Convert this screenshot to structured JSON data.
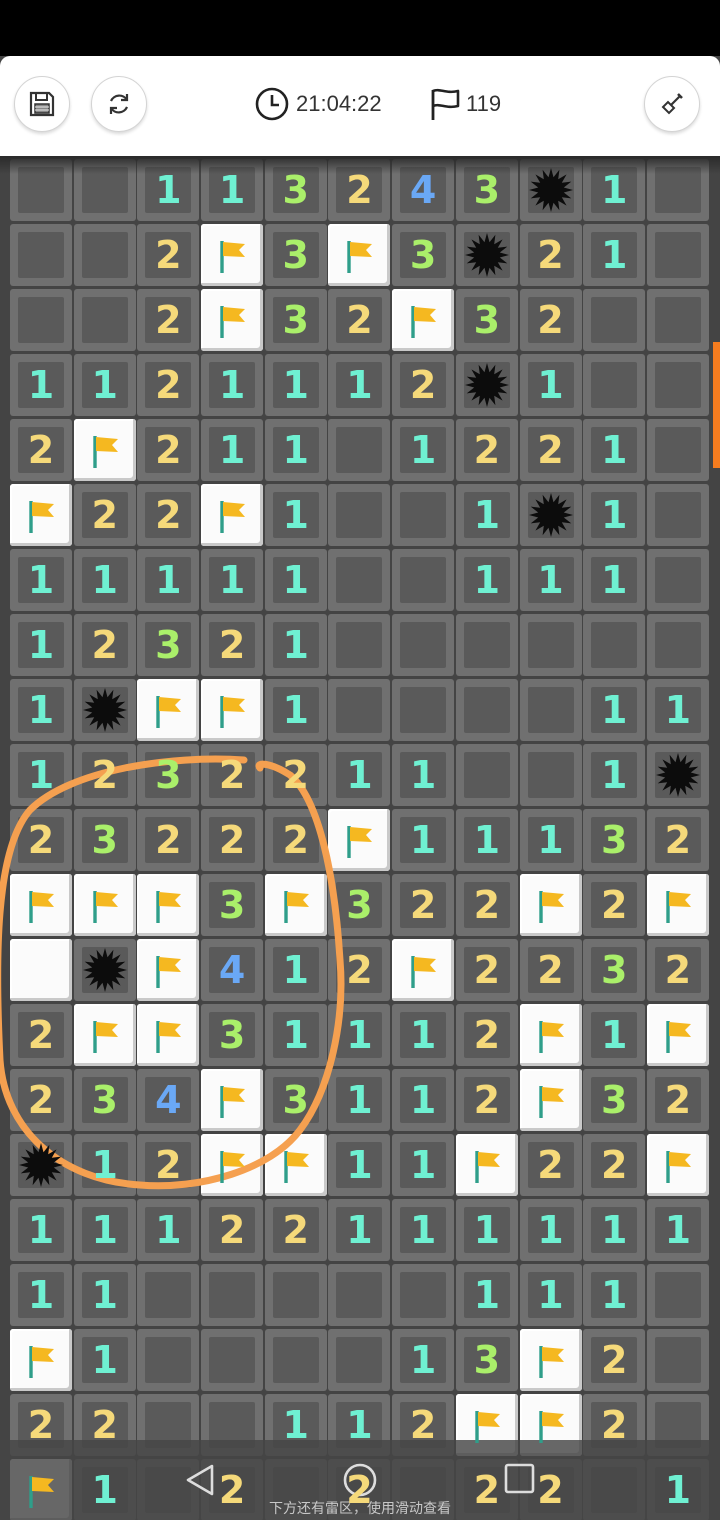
{
  "toolbar": {
    "timer": "21:04:22",
    "flag_count": "119",
    "save_icon": "floppy-disk-icon",
    "restart_icon": "refresh-icon",
    "clock_icon": "clock-icon",
    "flag_icon": "flag-outline-icon",
    "shovel_icon": "shovel-icon"
  },
  "board": {
    "columns": 11,
    "legend": "N = covered, E = opened empty, digits = adjacent mine count, F = flag, M = mine, W = white raised tile",
    "rows": [
      "NN113243M1N",
      "NN2F3F3M21N",
      "NN2F32F32NN",
      "1121112M1NN",
      "2F211E1221N",
      "F22F1EE1M1N",
      "11111EE111N",
      "12321EEEEEN",
      "1MFF1EEEE11",
      "1232211EE1M",
      "23222F11132",
      "FFF3F322F2F",
      "WMF412F2232",
      "2FF31112F1F",
      "234F3112F32",
      "M12FF11F22F",
      "11122111111",
      "11NNNNN111N",
      "F1NNNN13F2N",
      "22NN112FF2N",
      "F1N2N2N22N1"
    ],
    "colors": {
      "1": "#6ff0d2",
      "2": "#f5d97a",
      "3": "#aaef6a",
      "4": "#6aa8f5",
      "flag": "#f5b820",
      "annotation": "#f5a050",
      "scroll_thumb": "#f57c1f"
    }
  },
  "nav": {
    "hint": "下方还有雷区，使用滑动查看",
    "back_icon": "triangle-back-icon",
    "home_icon": "circle-home-icon",
    "recent_icon": "square-recent-icon"
  }
}
